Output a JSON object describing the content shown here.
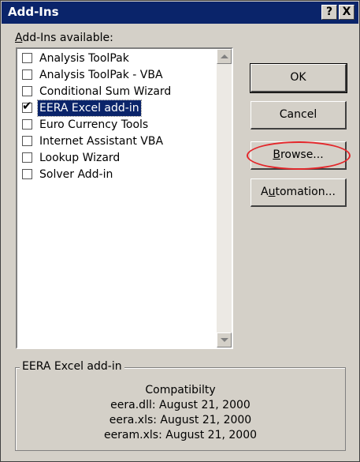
{
  "window": {
    "title": "Add-Ins",
    "help_glyph": "?",
    "close_glyph": "X"
  },
  "list": {
    "label": "Add-Ins available:",
    "items": [
      {
        "label": "Analysis ToolPak",
        "checked": false,
        "selected": false
      },
      {
        "label": "Analysis ToolPak - VBA",
        "checked": false,
        "selected": false
      },
      {
        "label": "Conditional Sum Wizard",
        "checked": false,
        "selected": false
      },
      {
        "label": "EERA Excel add-in",
        "checked": true,
        "selected": true
      },
      {
        "label": "Euro Currency Tools",
        "checked": false,
        "selected": false
      },
      {
        "label": "Internet Assistant VBA",
        "checked": false,
        "selected": false
      },
      {
        "label": "Lookup Wizard",
        "checked": false,
        "selected": false
      },
      {
        "label": "Solver Add-in",
        "checked": false,
        "selected": false
      }
    ]
  },
  "buttons": {
    "ok": "OK",
    "cancel": "Cancel",
    "browse": "Browse...",
    "automation": "Automation..."
  },
  "description": {
    "title": "EERA Excel add-in",
    "lines": [
      "Compatibilty",
      "eera.dll: August 21, 2000",
      "eera.xls: August 21, 2000",
      "eeram.xls: August 21, 2000"
    ]
  },
  "colors": {
    "titlebar": "#0a246a",
    "dialog_bg": "#d4d0c8",
    "selection": "#0a246a",
    "annotation_ring": "#e3262a"
  }
}
